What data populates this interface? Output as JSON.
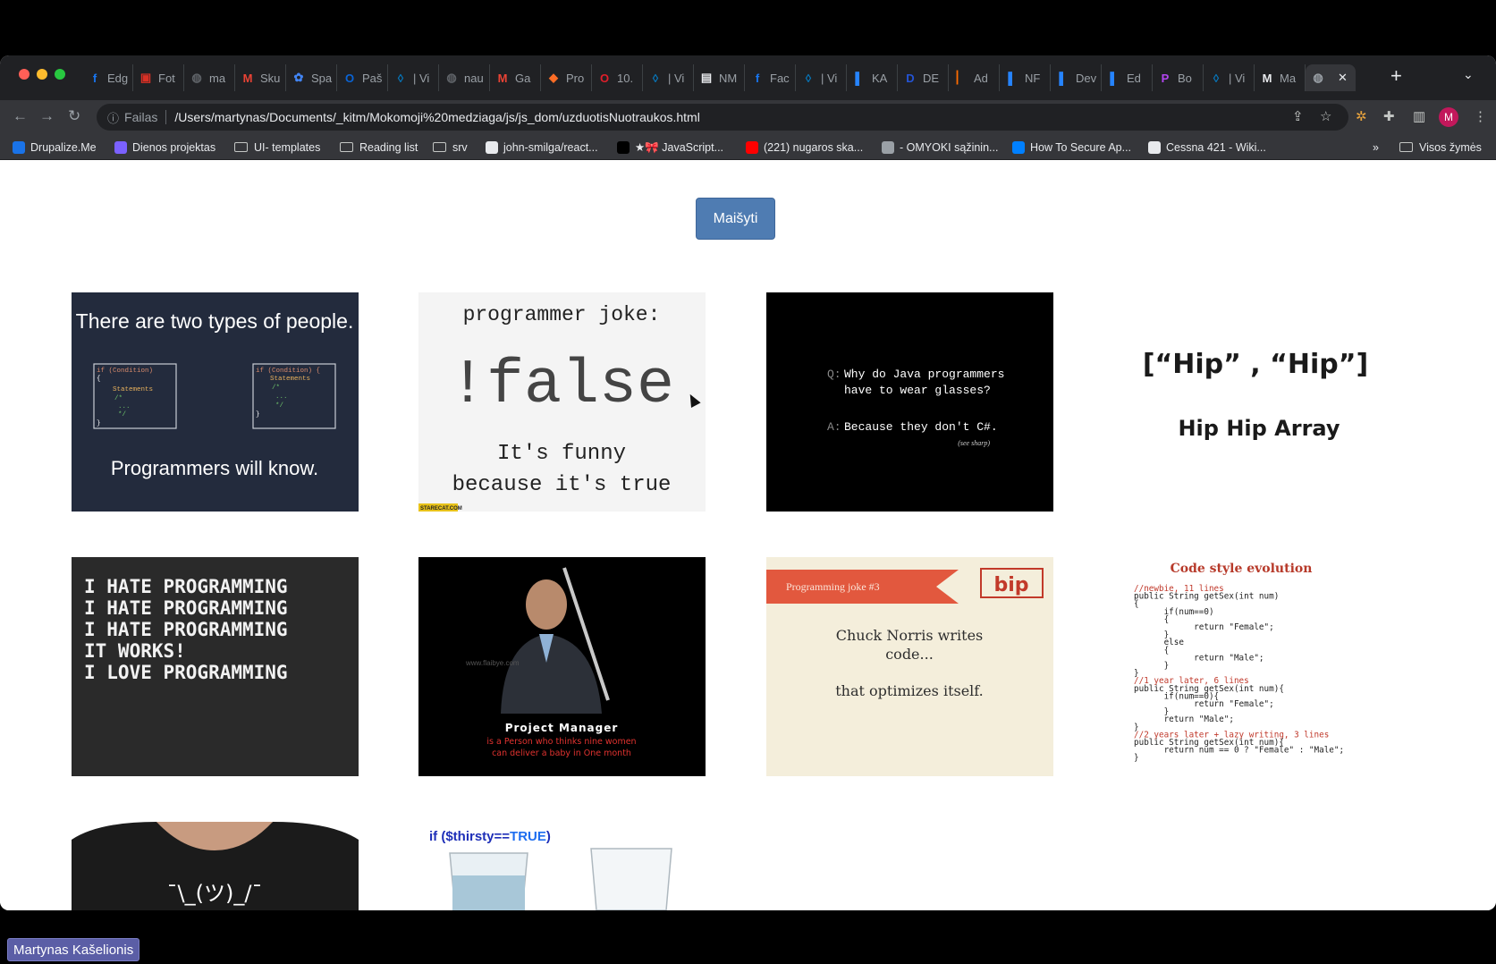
{
  "browser": {
    "tabs": [
      {
        "title": "Edg",
        "icon": "facebook-icon",
        "color": "#1877f2",
        "glyph": "f"
      },
      {
        "title": "Fot",
        "icon": "photo-app-icon",
        "color": "#d93025",
        "glyph": "▣"
      },
      {
        "title": "ma",
        "icon": "globe-icon",
        "color": "#5f6368",
        "glyph": "◍"
      },
      {
        "title": "Sku",
        "icon": "gmail-icon",
        "color": "#ea4335",
        "glyph": "M"
      },
      {
        "title": "Spa",
        "icon": "teams-app-icon",
        "color": "#4285f4",
        "glyph": "✿"
      },
      {
        "title": "Paš",
        "icon": "outlook-icon",
        "color": "#0a64d6",
        "glyph": "O"
      },
      {
        "title": "| Vi",
        "icon": "drupal-icon",
        "color": "#0678be",
        "glyph": "◊"
      },
      {
        "title": "nau",
        "icon": "globe-icon",
        "color": "#5f6368",
        "glyph": "◍"
      },
      {
        "title": "Ga",
        "icon": "gmail-icon",
        "color": "#ea4335",
        "glyph": "M"
      },
      {
        "title": "Pro",
        "icon": "gitlab-icon",
        "color": "#fc6d26",
        "glyph": "◆"
      },
      {
        "title": "10.",
        "icon": "opera-icon",
        "color": "#e01e2a",
        "glyph": "O"
      },
      {
        "title": "| Vi",
        "icon": "drupal-icon",
        "color": "#0678be",
        "glyph": "◊"
      },
      {
        "title": "NM",
        "icon": "nm-icon",
        "color": "#e8eaed",
        "glyph": "▤"
      },
      {
        "title": "Fac",
        "icon": "facebook-icon",
        "color": "#1877f2",
        "glyph": "f"
      },
      {
        "title": "| Vi",
        "icon": "drupal-icon",
        "color": "#0678be",
        "glyph": "◊"
      },
      {
        "title": "KA",
        "icon": "jira-icon",
        "color": "#2684ff",
        "glyph": "▌"
      },
      {
        "title": "DE",
        "icon": "d-app-icon",
        "color": "#2454d6",
        "glyph": "D"
      },
      {
        "title": "Ad",
        "icon": "orange-bar-icon",
        "color": "#ff6d00",
        "glyph": "▏"
      },
      {
        "title": "NF",
        "icon": "jira-icon",
        "color": "#2684ff",
        "glyph": "▌"
      },
      {
        "title": "Dev",
        "icon": "jira-icon",
        "color": "#2684ff",
        "glyph": "▌"
      },
      {
        "title": "Ed",
        "icon": "jira-icon",
        "color": "#2684ff",
        "glyph": "▌"
      },
      {
        "title": "Bo",
        "icon": "phpstorm-icon",
        "color": "#b345f1",
        "glyph": "P"
      },
      {
        "title": "| Vi",
        "icon": "drupal-icon",
        "color": "#0678be",
        "glyph": "◊"
      },
      {
        "title": "Ma",
        "icon": "medium-icon",
        "color": "#e8eaed",
        "glyph": "M"
      },
      {
        "title": "",
        "icon": "globe-icon",
        "color": "#9aa0a6",
        "glyph": "◍",
        "active": true
      }
    ],
    "address": {
      "scheme": "Failas",
      "url": "/Users/martynas/Documents/_kitm/Mokomoji%20medziaga/js/js_dom/uzduotisNuotraukos.html"
    },
    "avatar_letter": "M",
    "bookmarks": [
      {
        "label": "Drupalize.Me",
        "icon": "drupalize-icon",
        "color": "#1a73e8"
      },
      {
        "label": "Dienos projektas",
        "icon": "project-icon",
        "color": "#7b61ff"
      },
      {
        "label": "UI- templates",
        "icon": "folder-icon",
        "color": ""
      },
      {
        "label": "Reading list",
        "icon": "folder-icon",
        "color": ""
      },
      {
        "label": "srv",
        "icon": "folder-icon",
        "color": ""
      },
      {
        "label": "john-smilga/react...",
        "icon": "github-icon",
        "color": "#e8eaed"
      },
      {
        "label": "★🎀 JavaScript...",
        "icon": "dev-icon",
        "color": "#000"
      },
      {
        "label": "(221) nugaros ska...",
        "icon": "youtube-icon",
        "color": "#ff0000"
      },
      {
        "label": "- OMYOKI sąžinin...",
        "icon": "gear-icon",
        "color": "#9aa0a6"
      },
      {
        "label": "How To Secure Ap...",
        "icon": "digitalocean-icon",
        "color": "#0080ff"
      },
      {
        "label": "Cessna 421 - Wiki...",
        "icon": "wikipedia-icon",
        "color": "#e8eaed"
      }
    ],
    "more_bookmarks": "»",
    "all_bookmarks": "Visos žymės"
  },
  "page": {
    "shuffle_button": "Maišyti",
    "memes": {
      "two_types": {
        "title": "There are two types of people.",
        "code1": "if (Condition)\n{\n  Statements\n  /*\n   ...\n  */\n}",
        "code2": "if (Condition) {\n  Statements\n  /*\n   ...\n  */\n}",
        "caption": "Programmers will know."
      },
      "false_joke": {
        "top": "programmer joke:",
        "big": "!false",
        "bottom1": "It's funny",
        "bottom2": "because it's true",
        "tag": "STARECAT.COM"
      },
      "java": {
        "q_label": "Q:",
        "q": "Why do Java programmers\nhave to wear glasses?",
        "a_label": "A:",
        "a": "Because they don't C#.",
        "note": "(see sharp)"
      },
      "hip": {
        "top": "[“Hip” , “Hip”]",
        "bottom": "Hip Hip Array"
      },
      "hate": {
        "lines": [
          "I HATE PROGRAMMING",
          "I HATE PROGRAMMING",
          "I HATE PROGRAMMING",
          "IT WORKS!",
          "I LOVE PROGRAMMING"
        ]
      },
      "pm": {
        "watermark": "www.flaibye.com",
        "title": "Project Manager",
        "l1": "is a Person who thinks nine women",
        "l2": "can deliver a baby in One month"
      },
      "chuck": {
        "label": "Programming joke #3",
        "logo": "bip",
        "l1": "Chuck Norris writes",
        "l2": "code...",
        "l3": "that optimizes itself."
      },
      "code_style": {
        "title": "Code style evolution",
        "code": "//newbie, 11 lines\npublic String getSex(int num)\n{\n      if(num==0)\n      {\n            return \"Female\";\n      }\n      else\n      {\n            return \"Male\";\n      }\n}\n//1 year later, 6 lines\npublic String getSex(int num){\n      if(num==0){\n            return \"Female\";\n      }\n      return \"Male\";\n}\n//2 years later + lazy writing, 3 lines\npublic String getSex(int num){\n      return num == 0 ? \"Female\" : \"Male\";\n}"
      },
      "shrug": {
        "face": "¯\\_(ツ)_/¯"
      },
      "thirsty": {
        "code": "if ($thirsty==",
        "code_true": "TRUE",
        "code_end": ")"
      }
    }
  },
  "dock": {
    "user_name": "Martynas Kašelionis"
  }
}
